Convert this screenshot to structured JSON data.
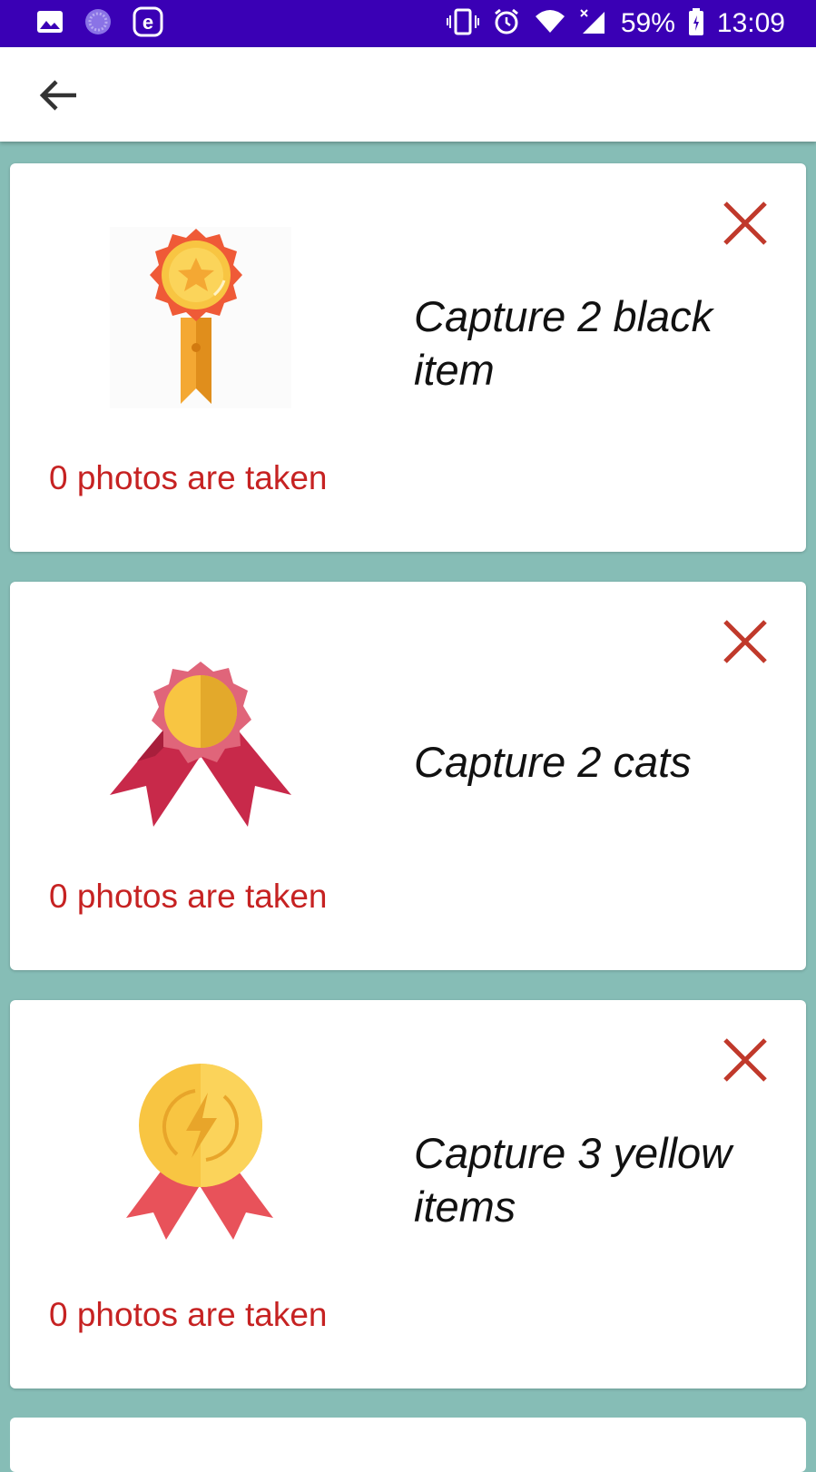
{
  "status_bar": {
    "battery": "59%",
    "time": "13:09"
  },
  "app_bar": {
    "back_icon": "arrow-left-icon"
  },
  "colors": {
    "status_bar": "#3a00b5",
    "background": "#86bdb6",
    "close_icon": "#c0392b",
    "count_text": "#c62222"
  },
  "cards": [
    {
      "title": "Capture 2 black item",
      "count_text": "0 photos are taken",
      "badge_icon": "star-medal-icon"
    },
    {
      "title": "Capture 2 cats",
      "count_text": "0 photos are taken",
      "badge_icon": "rosette-medal-icon"
    },
    {
      "title": "Capture 3 yellow items",
      "count_text": "0 photos are taken",
      "badge_icon": "lightning-medal-icon"
    }
  ]
}
